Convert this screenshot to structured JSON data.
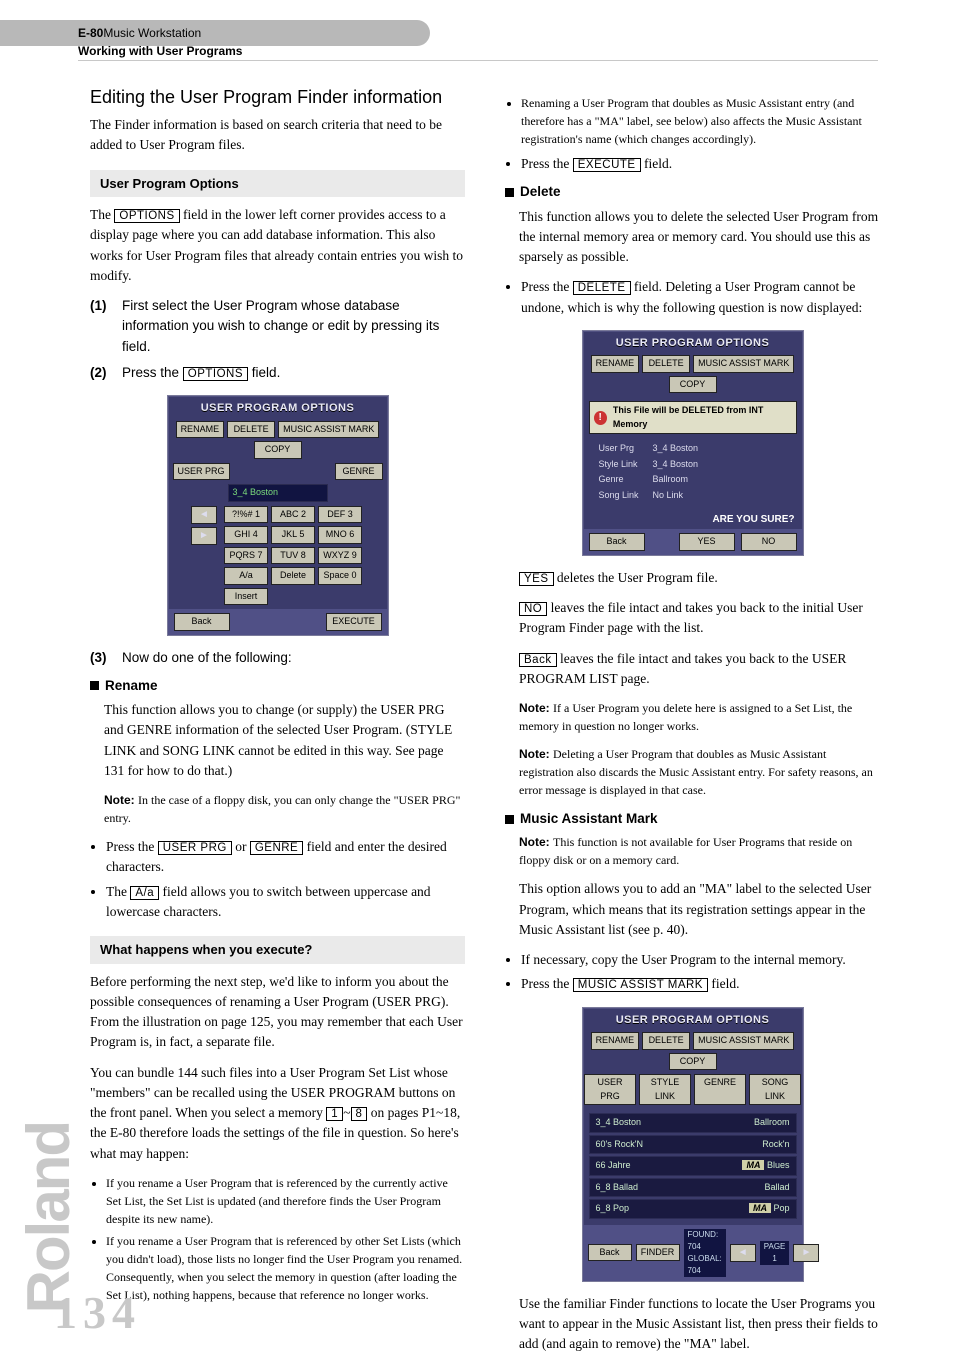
{
  "header": {
    "product_bold": "E-80",
    "product_rest": " Music Workstation",
    "sub": "Working with User Programs"
  },
  "brand": "Roland",
  "page_number": "134",
  "col1": {
    "h2": "Editing the User Program Finder information",
    "intro": "The Finder information is based on search criteria that need to be added to User Program files.",
    "h3_opts": "User Program Options",
    "opts_p1_a": "The ",
    "opts_p1_field": "OPTIONS",
    "opts_p1_b": " field in the lower left corner provides access to a display page where you can add database information. This also works for User Program files that already contain entries you wish to modify.",
    "step1_num": "(1)",
    "step1": "First select the User Program whose database information you wish to change or edit by pressing its field.",
    "step2_num": "(2)",
    "step2_a": "Press the ",
    "step2_field": "OPTIONS",
    "step2_b": " field.",
    "step3_num": "(3)",
    "step3": "Now do one of the following:",
    "rename_h": "Rename",
    "rename_p": "This function allows you to change (or supply) the USER PRG and GENRE information of the selected User Program. (STYLE LINK and SONG LINK cannot be edited in this way. See page 131 for how to do that.)",
    "rename_note": "In the case of a floppy disk, you can only change the \"USER PRG\" entry.",
    "rename_b1_a": "Press the ",
    "rename_b1_f1": "USER PRG",
    "rename_b1_mid": " or ",
    "rename_b1_f2": "GENRE",
    "rename_b1_b": " field and enter the desired characters.",
    "rename_b2_a": "The ",
    "rename_b2_f": "A/a",
    "rename_b2_b": " field allows you to switch between uppercase and lowercase characters.",
    "h3_exec": "What happens when you execute?",
    "exec_p1": "Before performing the next step, we'd like to inform you about the possible consequences of renaming a User Program (USER PRG). From the illustration on page 125, you may remember that each User Program is, in fact, a separate file.",
    "exec_p2_a": "You can bundle 144 such files into a User Program Set List whose \"members\" can be recalled using the USER PROGRAM buttons on the front panel. When you select a memory ",
    "exec_p2_f1": "1",
    "exec_p2_mid": "~",
    "exec_p2_f2": "8",
    "exec_p2_b": " on pages P1~18, the E-80 therefore loads the settings of the file in question. So here's what may happen:",
    "exec_b1": "If you rename a User Program that is referenced by the currently active Set List, the Set List is updated (and therefore finds the User Program despite its new name).",
    "exec_b2": "If you rename a User Program that is referenced by other Set Lists (which you didn't load), those lists no longer find the User Program you renamed. Consequently, when you select the memory in question (after loading the Set List), nothing happens, because that reference no longer works."
  },
  "col2": {
    "top_b1": "Renaming a User Program that doubles as Music Assistant entry (and therefore has a \"MA\" label, see below) also affects the Music Assistant registration's name (which changes accordingly).",
    "top_b2_a": "Press the ",
    "top_b2_f": "EXECUTE",
    "top_b2_b": " field.",
    "del_h": "Delete",
    "del_p": "This function allows you to delete the selected User Program from the internal memory area or memory card. You should use this as sparsely as possible.",
    "del_b1_a": "Press the ",
    "del_b1_f": "DELETE",
    "del_b1_b": " field. Deleting a User Program cannot be undone, which is why the following question is now displayed:",
    "after_yes_f": "YES",
    "after_yes_t": " deletes the User Program file.",
    "after_no_f": "NO",
    "after_no_t": " leaves the file intact and takes you back to the initial User Program Finder page with the list.",
    "after_back_f": "Back",
    "after_back_t": " leaves the file intact and takes you back to the USER PROGRAM LIST page.",
    "del_note1": "If a User Program you delete here is assigned to a Set List, the memory in question no longer works.",
    "del_note2": "Deleting a User Program that doubles as Music Assistant registration also discards the Music Assistant entry. For safety reasons, an error message is displayed in that case.",
    "ma_h": "Music Assistant Mark",
    "ma_note": "This function is not available for User Programs that reside on floppy disk or on a memory card.",
    "ma_p": "This option allows you to add an \"MA\" label to the selected User Program, which means that its registration settings appear in the Music Assistant list (see p. 40).",
    "ma_b1": "If necessary, copy the User Program to the internal memory.",
    "ma_b2_a": "Press the ",
    "ma_b2_f": "MUSIC ASSIST MARK",
    "ma_b2_b": " field.",
    "ma_after": "Use the familiar Finder functions to locate the User Programs you want to appear in the Music Assistant list, then press their fields to add (and again to remove) the \"MA\" label."
  },
  "fig1": {
    "title": "USER PROGRAM OPTIONS",
    "tabs": [
      "RENAME",
      "DELETE",
      "MUSIC ASSIST MARK",
      "COPY"
    ],
    "left_btn": "USER PRG",
    "right_btn": "GENRE",
    "slot": "3_4 Boston",
    "keypad": [
      "?!%# 1",
      "ABC 2",
      "DEF 3",
      "GHI 4",
      "JKL 5",
      "MNO 6",
      "PQRS 7",
      "TUV 8",
      "WXYZ 9",
      "A/a",
      "Delete",
      "Space 0",
      "Insert"
    ],
    "back": "Back",
    "exec": "EXECUTE"
  },
  "fig2": {
    "title": "USER PROGRAM OPTIONS",
    "tabs": [
      "RENAME",
      "DELETE",
      "MUSIC ASSIST MARK",
      "COPY"
    ],
    "warn": "This File will be DELETED from INT Memory",
    "rows": [
      [
        "User Prg",
        "3_4 Boston"
      ],
      [
        "Style Link",
        "3_4 Boston"
      ],
      [
        "Genre",
        "Ballroom"
      ],
      [
        "Song Link",
        "No Link"
      ]
    ],
    "q": "ARE YOU SURE?",
    "back": "Back",
    "yes": "YES",
    "no": "NO"
  },
  "fig3": {
    "title": "USER PROGRAM OPTIONS",
    "tabs": [
      "RENAME",
      "DELETE",
      "MUSIC ASSIST MARK",
      "COPY"
    ],
    "sort": [
      "USER PRG",
      "STYLE LINK",
      "GENRE",
      "SONG LINK"
    ],
    "list": [
      {
        "name": "3_4 Boston",
        "genre": "Ballroom",
        "ma": false
      },
      {
        "name": "60's Rock'N",
        "genre": "Rock'n",
        "ma": false
      },
      {
        "name": "66 Jahre",
        "genre": "Blues",
        "ma": true
      },
      {
        "name": "6_8 Ballad",
        "genre": "Ballad",
        "ma": false
      },
      {
        "name": "6_8 Pop",
        "genre": "Pop",
        "ma": true
      }
    ],
    "back": "Back",
    "finder": "FINDER",
    "found": "FOUND: 704",
    "global": "GLOBAL: 704",
    "page_lbl": "PAGE",
    "page_num": "1"
  },
  "labels": {
    "note": "Note: "
  }
}
